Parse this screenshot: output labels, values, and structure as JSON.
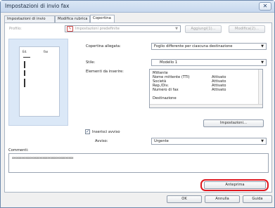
{
  "window": {
    "title": "Impostazioni di invio fax",
    "close_glyph": "✕"
  },
  "tabs": [
    {
      "label": "Impostazioni di invio"
    },
    {
      "label": "Modifica rubrica"
    },
    {
      "label": "Copertina"
    }
  ],
  "profile": {
    "label": "Profilo:",
    "value": "Impostazioni predefinite",
    "add_label": "Aggiungi(1)...",
    "edit_label": "Modifica(2)..."
  },
  "preview": {
    "page_marker": "Ed.",
    "fax_marker": "fax"
  },
  "cover": {
    "attached_label": "Copertina allegata:",
    "attached_value": "Foglio differente per ciascuna destinazione",
    "style_label": "Stile:",
    "style_value": "Modello 1",
    "elements_label": "Elementi da inserire:",
    "elements": [
      {
        "name": "Mittente",
        "value": ""
      },
      {
        "name": "Nome mittente (TTI)",
        "value": "Attivato"
      },
      {
        "name": "Società",
        "value": "Attivato"
      },
      {
        "name": "Rep./Div.",
        "value": "Attivato"
      },
      {
        "name": "Numero di fax",
        "value": "Attivato"
      },
      {
        "name": "",
        "value": ""
      },
      {
        "name": "Destinazione",
        "value": ""
      }
    ],
    "settings_label": "Impostazioni..."
  },
  "notice": {
    "checkbox_label": "Inserisci avviso",
    "checked_glyph": "✓",
    "notice_label": "Avviso:",
    "notice_value": "Urgente"
  },
  "comments": {
    "label": "Commenti:",
    "value": "xxxxxxxxxxxxxxxxxxxxxxxxxxxxxxxxxxxxxxxx"
  },
  "actions": {
    "preview_label": "Anteprima",
    "ok_label": "OK",
    "cancel_label": "Annulla",
    "help_label": "Guida"
  },
  "colors": {
    "highlight": "#e0161e",
    "preview_bg": "#dbe8f7"
  }
}
